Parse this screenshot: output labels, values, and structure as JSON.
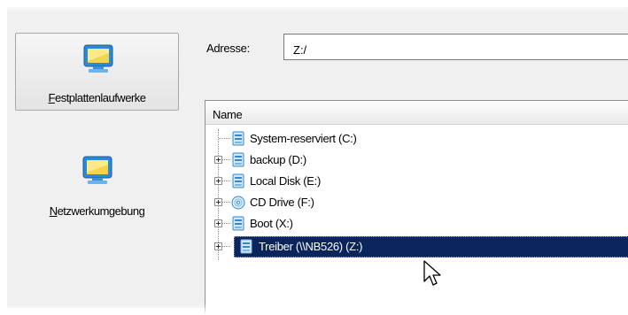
{
  "nav": {
    "items": [
      {
        "label_accel": "F",
        "label_rest": "estplattenlaufwerke",
        "icon": "computer-monitor-icon"
      },
      {
        "label_accel": "N",
        "label_rest": "etzwerkumgebung",
        "icon": "computer-monitor-icon"
      }
    ]
  },
  "address": {
    "label": "Adresse:",
    "value": "Z:/"
  },
  "tree": {
    "column_header": "Name",
    "items": [
      {
        "label": "System-reserviert (C:)",
        "icon": "drive-icon",
        "expandable": false,
        "selected": false
      },
      {
        "label": "backup (D:)",
        "icon": "drive-icon",
        "expandable": true,
        "selected": false
      },
      {
        "label": "Local Disk (E:)",
        "icon": "drive-icon",
        "expandable": true,
        "selected": false
      },
      {
        "label": "CD Drive (F:)",
        "icon": "cd-drive-icon",
        "expandable": true,
        "selected": false
      },
      {
        "label": "Boot (X:)",
        "icon": "drive-icon",
        "expandable": true,
        "selected": false
      },
      {
        "label": "Treiber (\\\\NB526) (Z:)",
        "icon": "network-drive-icon",
        "expandable": true,
        "selected": true
      }
    ]
  },
  "colors": {
    "selection": "#0b245b",
    "panel": "#f0f0f0"
  }
}
